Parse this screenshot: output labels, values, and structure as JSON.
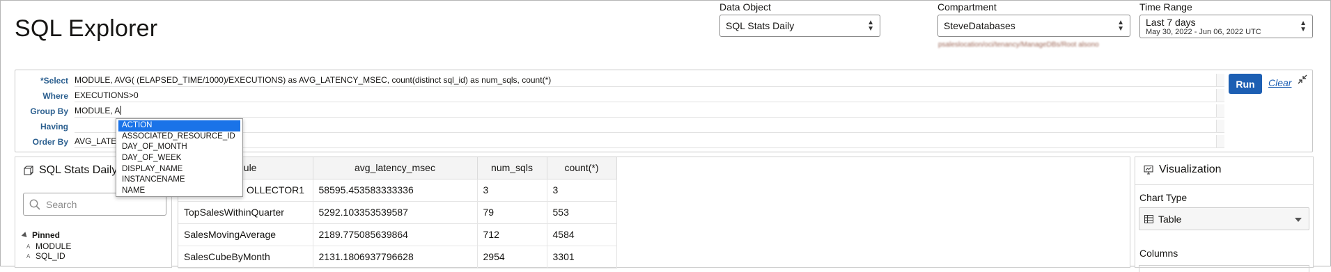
{
  "header": {
    "title": "SQL Explorer",
    "data_object": {
      "label": "Data Object",
      "value": "SQL Stats Daily"
    },
    "compartment": {
      "label": "Compartment",
      "value": "SteveDatabases",
      "subtext": "psaleslocation/oci/tenancy/ManageDBs/Root alsono"
    },
    "time_range": {
      "label": "Time Range",
      "value": "Last 7 days",
      "range": "May 30, 2022 - Jun 06, 2022 UTC"
    }
  },
  "query": {
    "select": {
      "label": "*Select",
      "value": "MODULE, AVG( (ELAPSED_TIME/1000)/EXECUTIONS) as AVG_LATENCY_MSEC, count(distinct sql_id) as num_sqls, count(*)"
    },
    "where": {
      "label": "Where",
      "value": "EXECUTIONS>0"
    },
    "group_by": {
      "label": "Group By",
      "value": "MODULE, A"
    },
    "having": {
      "label": "Having",
      "value": ""
    },
    "order_by": {
      "label": "Order By",
      "value": "AVG_LATE"
    },
    "run_label": "Run",
    "clear_label": "Clear"
  },
  "autocomplete": {
    "items": [
      "ACTION",
      "ASSOCIATED_RESOURCE_ID",
      "DAY_OF_MONTH",
      "DAY_OF_WEEK",
      "DISPLAY_NAME",
      "INSTANCENAME",
      "NAME"
    ],
    "selected_index": 0
  },
  "left_panel": {
    "title": "SQL Stats Daily",
    "search_placeholder": "Search",
    "pinned_label": "Pinned",
    "pinned_items": [
      "MODULE",
      "SQL_ID"
    ]
  },
  "results": {
    "columns": [
      "module",
      "avg_latency_msec",
      "num_sqls",
      "count(*)"
    ],
    "visible_headers": [
      "dule",
      "avg_latency_msec",
      "num_sqls",
      "count(*)"
    ],
    "rows": [
      [
        "OLLECTOR1",
        "58595.453583333336",
        "3",
        "3"
      ],
      [
        "TopSalesWithinQuarter",
        "5292.103353539587",
        "79",
        "553"
      ],
      [
        "SalesMovingAverage",
        "2189.775085639864",
        "712",
        "4584"
      ],
      [
        "SalesCubeByMonth",
        "2131.1806937796628",
        "2954",
        "3301"
      ]
    ]
  },
  "visualization": {
    "title": "Visualization",
    "chart_type_label": "Chart Type",
    "chart_type_value": "Table",
    "columns_label": "Columns"
  },
  "colors": {
    "accent": "#1d5fb3",
    "label_blue": "#2b5f8f",
    "highlight": "#1a73e8"
  }
}
